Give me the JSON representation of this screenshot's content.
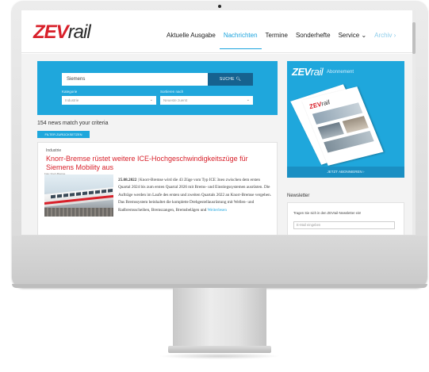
{
  "header": {
    "logo_zev": "ZEV",
    "logo_rail": "rail",
    "nav": [
      {
        "label": "Aktuelle Ausgabe"
      },
      {
        "label": "Nachrichten"
      },
      {
        "label": "Termine"
      },
      {
        "label": "Sonderhefte"
      },
      {
        "label": "Service ⌄"
      },
      {
        "label": "Archiv ›"
      }
    ]
  },
  "search": {
    "query": "Siemens",
    "button_label": "SUCHE",
    "filter1_label": "Kategorie",
    "filter1_value": "Industrie",
    "filter2_label": "Sortieren nach",
    "filter2_value": "Neueste zuerst"
  },
  "results": {
    "count_text": "154 news match your criteria",
    "reset_label": "FILTER ZURÜCKSETZEN"
  },
  "article": {
    "category": "Industrie",
    "title": "Knorr-Bremse rüstet weitere ICE-Hochgeschwindigkeitszüge für Siemens Mobility aus",
    "image_caption": "Foto: Knorr-Bremse",
    "date": "25.08.2022",
    "lead": "Knorr-Bremse wird die 43 Züge vom Typ ICE 3neo zwischen dem ersten Quartal 2024 bis zum ersten Quartal 2026 mit Brems- und Einstiegssystemen ausrüsten. Die Aufträge werden im Laufe des ersten und zweiten Quartals 2022 an Knorr-Bremse vergeben. Das Bremssystem beinhaltet die komplette Drehgestellausrüstung mit Wellen- und Radbremsscheiben, Bremszangen, Bremsbelägen und",
    "more_label": "Weiterlesen"
  },
  "sidebar": {
    "ad_logo_zev": "ZEV",
    "ad_logo_rail": "rail",
    "ad_subtitle": "Abonnement",
    "ad_cta": "JETZT ABONNIEREN ›",
    "newsletter_title": "Newsletter",
    "newsletter_text": "Tragen Sie sich in den ZEVrail-Newsletter ein!",
    "newsletter_placeholder": "E-Mail eingeben"
  },
  "colors": {
    "accent": "#1fa7dc",
    "brand_red": "#d8202a",
    "dark_blue": "#16628f"
  }
}
